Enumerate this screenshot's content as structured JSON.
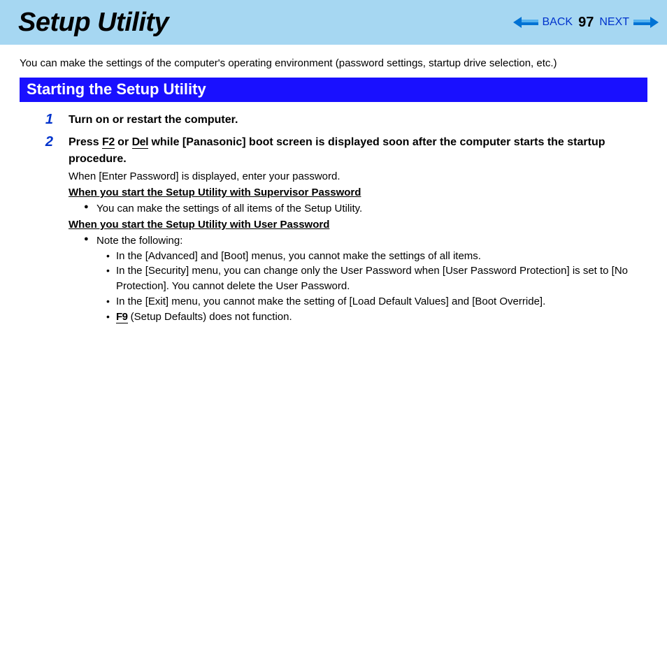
{
  "header": {
    "title": "Setup Utility",
    "back_label": "BACK",
    "page_number": "97",
    "next_label": "NEXT"
  },
  "intro_text": "You can make the settings of the computer's operating environment (password settings, startup drive selection, etc.)",
  "section_title": "Starting the Setup Utility",
  "steps": [
    {
      "num": "1",
      "heading": "Turn on or restart the computer."
    },
    {
      "num": "2",
      "heading_pre": "Press ",
      "key1": "F2",
      "heading_mid": " or ",
      "key2": "Del",
      "heading_post": " while [Panasonic] boot screen is displayed soon after the computer starts the startup procedure.",
      "line1": "When [Enter Password] is displayed, enter your password.",
      "subhead1": "When you start the Setup Utility with Supervisor Password",
      "bullet1": "You can make the settings of all items of the Setup Utility.",
      "subhead2": "When you start the Setup Utility with User Password",
      "bullet2": "Note the following:",
      "dashes": [
        "In the [Advanced] and [Boot] menus, you cannot make the settings of all items.",
        "In the [Security] menu, you can change only the User Password when [User Password Protection] is set to [No Protection]. You cannot delete the User Password.",
        "In the [Exit] menu, you cannot make the setting of [Load Default Values] and [Boot Override]."
      ],
      "dash4_key": "F9",
      "dash4_post": " (Setup Defaults) does not function."
    }
  ]
}
